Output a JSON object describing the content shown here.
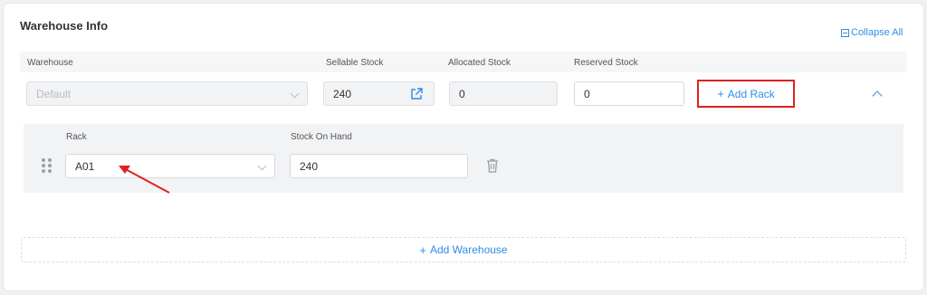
{
  "section": {
    "title": "Warehouse Info",
    "collapse_label": "Collapse All"
  },
  "columns": {
    "warehouse": "Warehouse",
    "sellable": "Sellable Stock",
    "allocated": "Allocated Stock",
    "reserved": "Reserved Stock"
  },
  "row": {
    "warehouse_placeholder": "Default",
    "sellable_value": "240",
    "allocated_value": "0",
    "reserved_value": "0",
    "add_rack_label": "Add Rack"
  },
  "rack": {
    "rack_header": "Rack",
    "stock_header": "Stock On Hand",
    "rack_value": "A01",
    "stock_value": "240"
  },
  "footer": {
    "add_warehouse_label": "Add Warehouse"
  },
  "colors": {
    "accent": "#2f8ee6",
    "highlight": "#e02020"
  }
}
